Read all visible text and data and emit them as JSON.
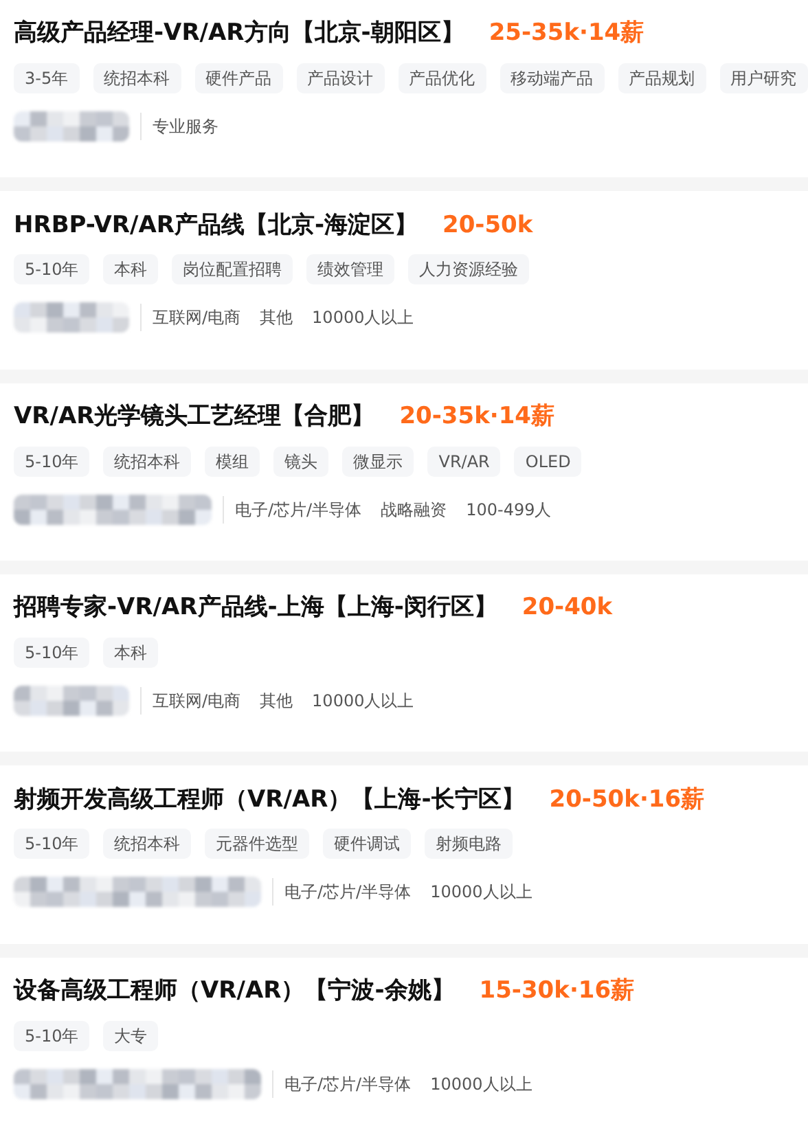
{
  "jobs": [
    {
      "title": "高级产品经理-VR/AR方向【北京-朝阳区】",
      "salary": "25-35k·14薪",
      "tags": [
        "3-5年",
        "统招本科",
        "硬件产品",
        "产品设计",
        "产品优化",
        "移动端产品",
        "产品规划",
        "用户研究"
      ],
      "company_info": [
        "专业服务"
      ]
    },
    {
      "title": "HRBP-VR/AR产品线【北京-海淀区】",
      "salary": "20-50k",
      "tags": [
        "5-10年",
        "本科",
        "岗位配置招聘",
        "绩效管理",
        "人力资源经验"
      ],
      "company_info": [
        "互联网/电商",
        "其他",
        "10000人以上"
      ]
    },
    {
      "title": "VR/AR光学镜头工艺经理【合肥】",
      "salary": "20-35k·14薪",
      "tags": [
        "5-10年",
        "统招本科",
        "模组",
        "镜头",
        "微显示",
        "VR/AR",
        "OLED"
      ],
      "company_info": [
        "电子/芯片/半导体",
        "战略融资",
        "100-499人"
      ]
    },
    {
      "title": "招聘专家-VR/AR产品线-上海【上海-闵行区】",
      "salary": "20-40k",
      "tags": [
        "5-10年",
        "本科"
      ],
      "company_info": [
        "互联网/电商",
        "其他",
        "10000人以上"
      ]
    },
    {
      "title": "射频开发高级工程师（VR/AR）【上海-长宁区】",
      "salary": "20-50k·16薪",
      "tags": [
        "5-10年",
        "统招本科",
        "元器件选型",
        "硬件调试",
        "射频电路"
      ],
      "company_info": [
        "电子/芯片/半导体",
        "10000人以上"
      ]
    },
    {
      "title": "设备高级工程师（VR/AR）【宁波-余姚】",
      "salary": "15-30k·16薪",
      "tags": [
        "5-10年",
        "大专"
      ],
      "company_info": [
        "电子/芯片/半导体",
        "10000人以上"
      ]
    }
  ]
}
